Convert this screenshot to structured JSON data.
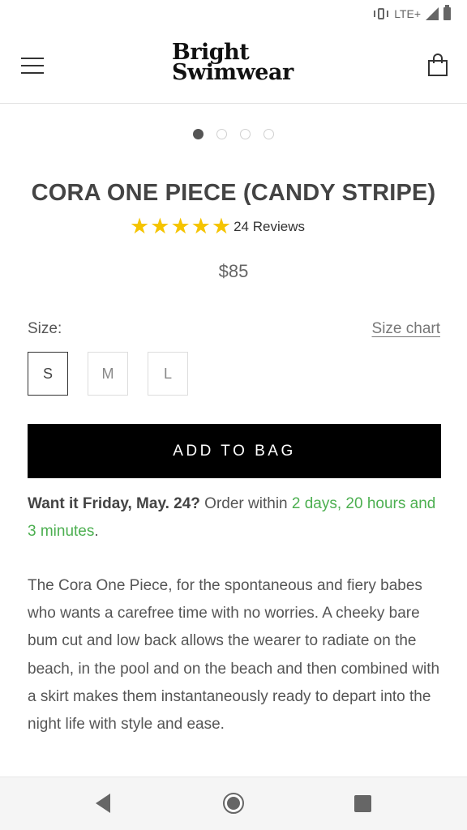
{
  "status_bar": {
    "network": "LTE+"
  },
  "header": {
    "logo_line1": "Bright",
    "logo_line2": "Swimwear"
  },
  "carousel": {
    "dot_count": 4,
    "active_index": 0
  },
  "product": {
    "title": "CORA ONE PIECE (CANDY STRIPE)",
    "rating_stars": 5,
    "reviews_label": "24 Reviews",
    "price": "$85"
  },
  "size": {
    "label": "Size:",
    "chart_link": "Size chart",
    "options": [
      "S",
      "M",
      "L"
    ],
    "selected": "S"
  },
  "cta": {
    "add_to_bag": "ADD TO BAG"
  },
  "delivery": {
    "bold": "Want it Friday, May. 24?",
    "order_within": " Order within ",
    "countdown": "2 days, 20 hours and 3 minutes",
    "end": "."
  },
  "description": "The Cora One Piece, for the spontaneous and fiery babes who wants a carefree time with no worries. A cheeky bare bum cut and low back allows the wearer to radiate on the beach, in the pool and on the beach and then combined with a skirt makes them instantaneously ready to depart into the night life with style and ease.",
  "colors": {
    "star": "#f5c400",
    "accent_green": "#4caf50",
    "button_bg": "#000000"
  }
}
